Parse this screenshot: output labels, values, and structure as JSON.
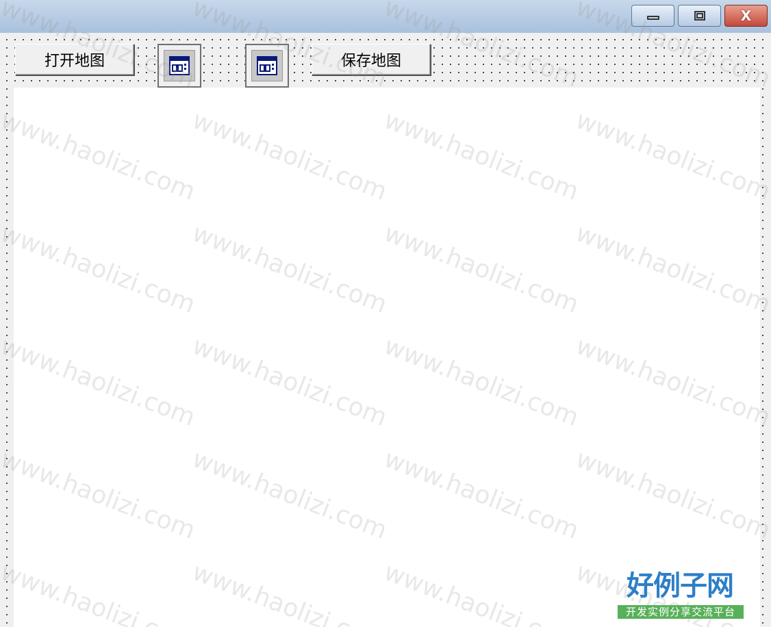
{
  "window": {
    "controls": {
      "minimize_icon": "minimize-icon",
      "maximize_icon": "maximize-icon",
      "close_icon": "close-icon",
      "close_glyph": "X"
    }
  },
  "toolbar": {
    "open_map_label": "打开地图",
    "save_map_label": "保存地图",
    "tool_buttons": [
      {
        "icon": "window-icon"
      },
      {
        "icon": "window-icon"
      }
    ]
  },
  "watermark": {
    "text": "www.haolizi.com",
    "logo_title": "好例子网",
    "logo_subtitle": "开发实例分享交流平台",
    "color": "#969696"
  },
  "colors": {
    "title_bar": "#b4c9e2",
    "close_button": "#c4493a",
    "logo_blue": "#2d7fc8",
    "logo_green": "#58b05a",
    "icon_navy": "#0a1a7a"
  }
}
